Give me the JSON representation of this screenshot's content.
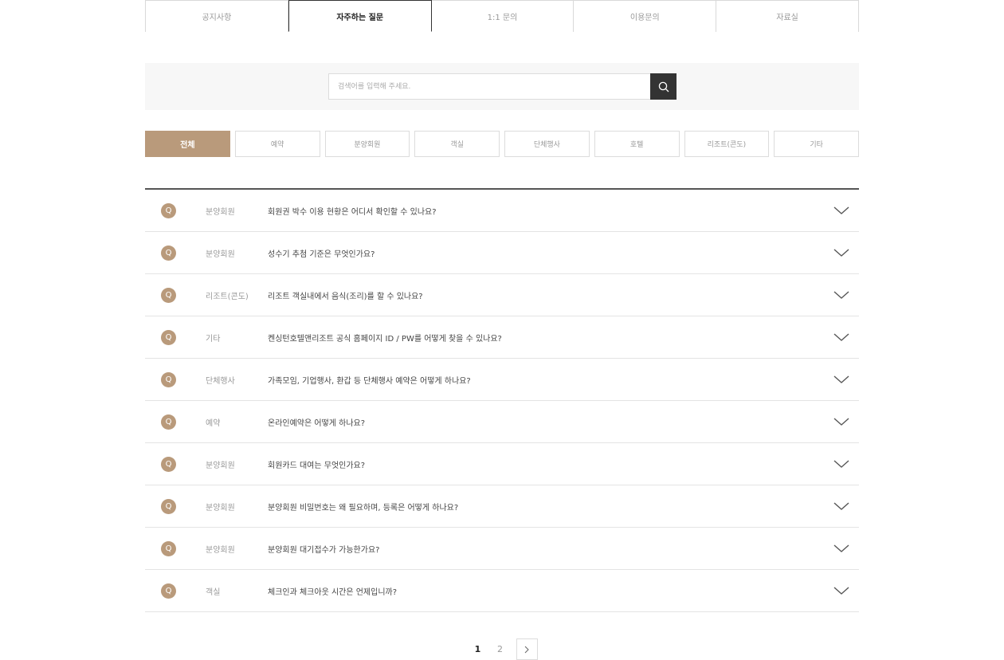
{
  "tabs": [
    {
      "label": "공지사항",
      "active": false
    },
    {
      "label": "자주하는 질문",
      "active": true
    },
    {
      "label": "1:1 문의",
      "active": false
    },
    {
      "label": "이용문의",
      "active": false
    },
    {
      "label": "자료실",
      "active": false
    }
  ],
  "search": {
    "placeholder": "검색어를 입력해 주세요.",
    "value": "",
    "button_icon": "search-icon"
  },
  "categories": [
    "전체",
    "예약",
    "분양회원",
    "객실",
    "단체행사",
    "호텔",
    "리조트(콘도)",
    "기타"
  ],
  "active_category": "전체",
  "faq": {
    "badge": "Q",
    "items": [
      {
        "category": "분양회원",
        "question": "회원권 박수 이용 현황은 어디서 확인할 수 있나요?"
      },
      {
        "category": "분양회원",
        "question": "성수기 추첨 기준은 무엇인가요?"
      },
      {
        "category": "리조트(콘도)",
        "question": "리조트 객실내에서 음식(조리)를 할 수 있나요?"
      },
      {
        "category": "기타",
        "question": "켄싱턴호텔앤리조트 공식 홈페이지 ID / PW를 어떻게 찾을 수 있나요?"
      },
      {
        "category": "단체행사",
        "question": "가족모임, 기업행사, 환갑 등 단체행사 예약은 어떻게 하나요?"
      },
      {
        "category": "예약",
        "question": "온라인예약은 어떻게 하나요?"
      },
      {
        "category": "분양회원",
        "question": "회원카드 대여는 무엇인가요?"
      },
      {
        "category": "분양회원",
        "question": "분양회원 비밀번호는 왜 필요하며, 등록은 어떻게 하나요?"
      },
      {
        "category": "분양회원",
        "question": "분양회원 대기접수가 가능한가요?"
      },
      {
        "category": "객실",
        "question": "체크인과 체크아웃 시간은 언제입니까?"
      }
    ]
  },
  "pagination": {
    "pages": [
      "1",
      "2"
    ],
    "current": "1",
    "next_icon": "chevron-right-icon"
  },
  "colors": {
    "accent": "#b99a7b",
    "dark": "#333333"
  }
}
